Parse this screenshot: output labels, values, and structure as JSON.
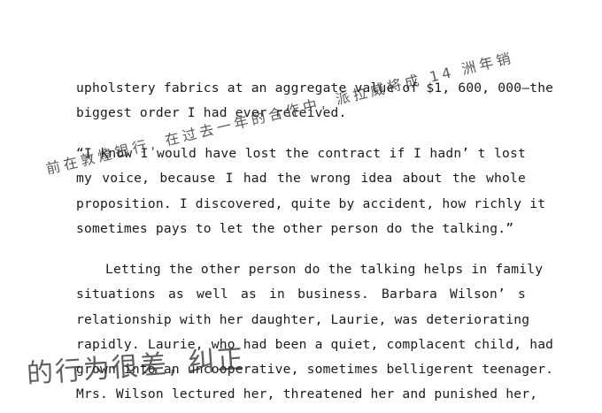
{
  "body": {
    "lines": [
      "upholstery fabrics at an aggregate value of $1, 600, 000—the",
      "biggest order I had ever received.",
      "“I know I would have lost the contract if I hadn’ t lost",
      "my voice, because I had the wrong idea about the whole",
      "proposition. I discovered, quite by accident, how richly it",
      "sometimes pays to let the other person do the talking.”",
      "Letting the other person do the talking helps in family",
      "situations as well as in business. Barbara Wilson’ s",
      "relationship with her daughter, Laurie, was deteriorating",
      "rapidly. Laurie, who had been a quiet, complacent child, had",
      "grown into an uncooperative, sometimes belligerent teenager.",
      "Mrs. Wilson lectured her, threatened her and punished her,"
    ]
  },
  "annotations": {
    "note_top": "前在敦煌银行, 在过去一年的合作中, 派拉威将成 14 洲年销",
    "note_bottom": "的行为很差, 纠正"
  }
}
